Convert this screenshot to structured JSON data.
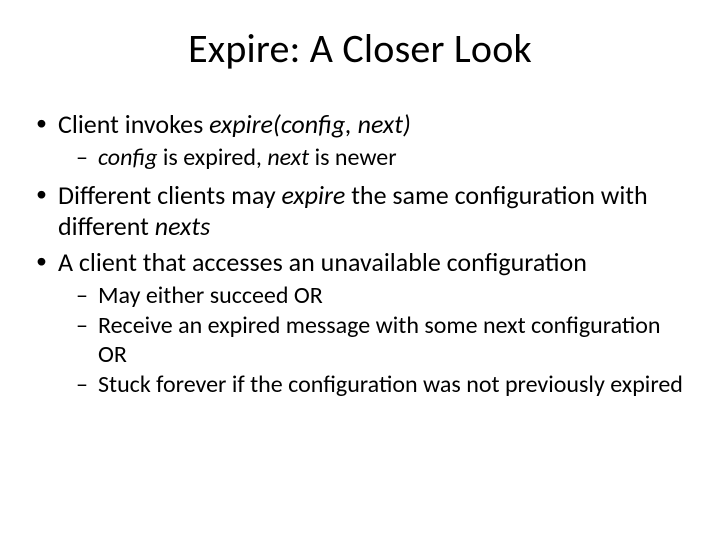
{
  "title": "Expire: A Closer Look",
  "b1": {
    "t1": "Client invokes ",
    "t2": "expire(config, next)",
    "s1": {
      "a": "config",
      "b": " is expired, ",
      "c": "next",
      "d": " is newer"
    }
  },
  "b2": {
    "a": "Different clients may ",
    "b": "expire",
    "c": " the same configuration with different ",
    "d": "nexts"
  },
  "b3": {
    "t": "A client that accesses an unavailable configuration",
    "s1": "May either succeed OR",
    "s2": "Receive an expired message with some next configuration OR",
    "s3": "Stuck forever if the configuration was not previously expired"
  }
}
